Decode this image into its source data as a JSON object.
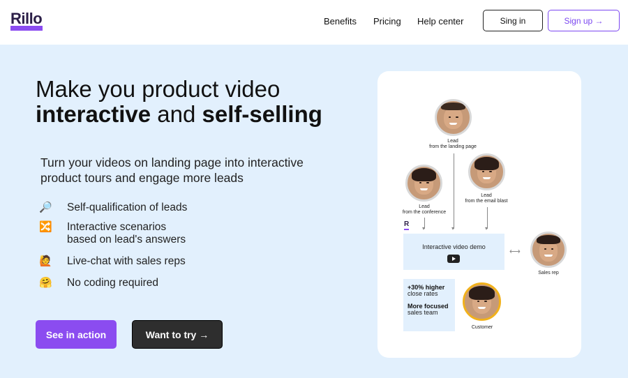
{
  "header": {
    "logo": "Rillo",
    "nav": [
      "Benefits",
      "Pricing",
      "Help center"
    ],
    "signin": "Sing in",
    "signup": "Sign up →"
  },
  "hero": {
    "line1": "Make you product video",
    "line2_bold1": "interactive",
    "line2_mid": " and ",
    "line2_bold2": "self-selling",
    "subtitle": "Turn your videos on landing page into interactive product tours and engage more leads",
    "features": [
      {
        "icon": "🔎",
        "text": "Self-qualification of leads"
      },
      {
        "icon": "🔀",
        "text": "Interactive scenarios",
        "text2": "based on lead's answers"
      },
      {
        "icon": "🙋",
        "text": "Live-chat with sales reps"
      },
      {
        "icon": "🤗",
        "text": "No coding required"
      }
    ],
    "cta_primary": "See in action",
    "cta_secondary": "Want to try →"
  },
  "diagram": {
    "lead_landing": [
      "Lead",
      "from the landing page"
    ],
    "lead_conf": [
      "Lead",
      "from the conference"
    ],
    "lead_email": [
      "Lead",
      "from the email blast"
    ],
    "mini_logo": "R",
    "demo": "Interactive video demo",
    "sales_rep": "Sales rep",
    "customer": "Customer",
    "stat1_bold": "+30% higher",
    "stat1": "close rates",
    "stat2_bold": "More focused",
    "stat2": "sales team"
  }
}
